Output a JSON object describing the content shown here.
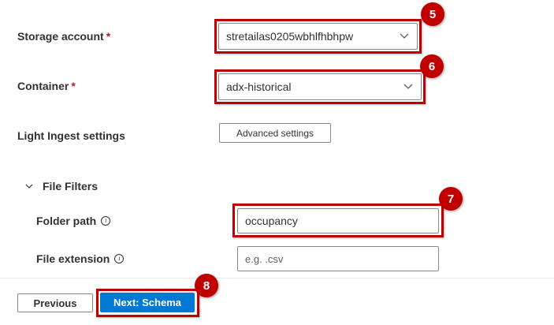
{
  "form": {
    "storage_account": {
      "label": "Storage account",
      "required": "*",
      "value": "stretailas0205wbhlfhbhpw"
    },
    "container": {
      "label": "Container",
      "required": "*",
      "value": "adx-historical"
    },
    "light_ingest": {
      "label": "Light Ingest settings",
      "button": "Advanced settings"
    },
    "file_filters": {
      "label": "File Filters",
      "folder_path": {
        "label": "Folder path",
        "info": "i",
        "value": "occupancy"
      },
      "file_extension": {
        "label": "File extension",
        "info": "i",
        "placeholder": "e.g. .csv"
      }
    }
  },
  "footer": {
    "previous": "Previous",
    "next": "Next: Schema"
  },
  "callouts": [
    "5",
    "6",
    "7",
    "8"
  ],
  "colors": {
    "callout": "#c00000",
    "primary": "#0078d4",
    "border": "#8a8886"
  }
}
